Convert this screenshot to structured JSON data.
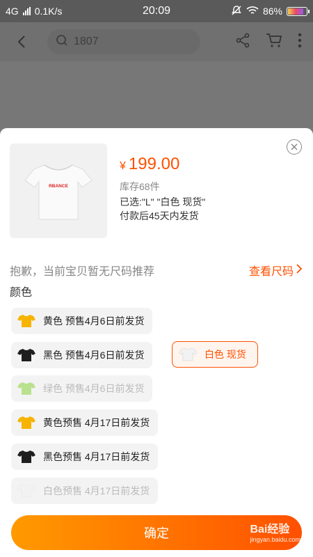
{
  "status_bar": {
    "network": "4G",
    "speed": "0.1K/s",
    "time": "20:09",
    "battery": "86%"
  },
  "nav": {
    "search_text": "1807"
  },
  "product": {
    "price_symbol": "¥",
    "price": "199.00",
    "stock": "库存68件",
    "selected": "已选:\"L\" \"白色 现货\"",
    "shipping": "付款后45天内发货",
    "logo_text": "RBANCE"
  },
  "size": {
    "no_size_notice": "抱歉，当前宝贝暂无尺码推荐",
    "size_chart_link": "查看尺码"
  },
  "color_section": {
    "title": "颜色"
  },
  "colors": [
    {
      "label": "黄色 预售4月6日前发货",
      "swatch": "#f6b400",
      "state": "normal"
    },
    {
      "label": "黑色 预售4月6日前发货",
      "swatch": "#1e1e1e",
      "state": "normal"
    },
    {
      "label": "白色 现货",
      "swatch": "#f2f2f2",
      "state": "selected"
    },
    {
      "label": "绿色 预售4月6日前发货",
      "swatch": "#8bd43a",
      "state": "disabled"
    },
    {
      "label": "黄色预售 4月17日前发货",
      "swatch": "#f6b400",
      "state": "normal"
    },
    {
      "label": "黑色预售 4月17日前发货",
      "swatch": "#1e1e1e",
      "state": "normal"
    },
    {
      "label": "白色预售 4月17日前发货",
      "swatch": "#f2f2f2",
      "state": "disabled"
    }
  ],
  "footer": {
    "confirm_label": "确定",
    "watermark": "Bai经验",
    "watermark_url": "jingyan.baidu.com"
  },
  "colors_theme": {
    "accent": "#ff5000",
    "accent_gradient_start": "#ff9a00"
  }
}
